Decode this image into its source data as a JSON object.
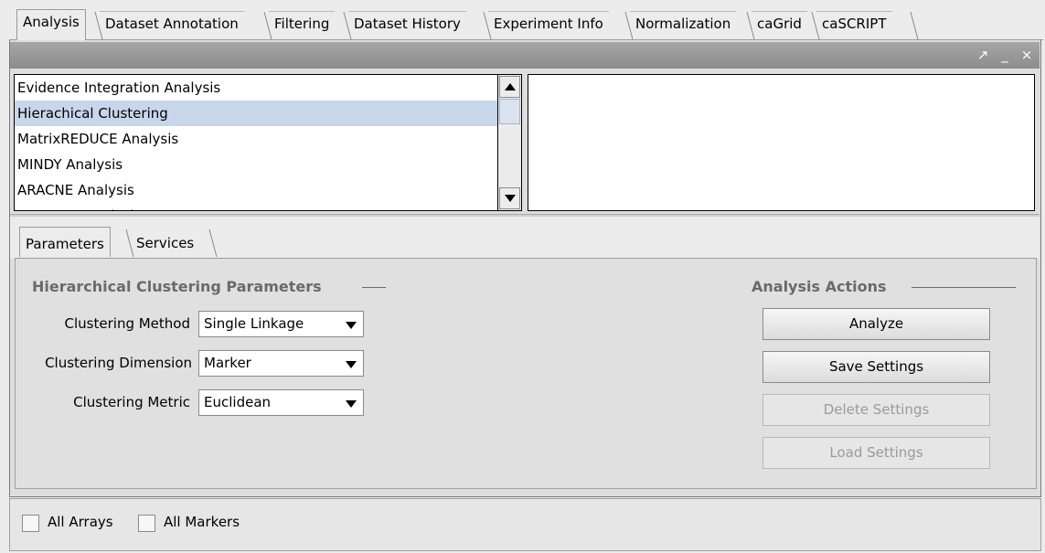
{
  "top_tabs": [
    {
      "label": "Analysis",
      "active": true
    },
    {
      "label": "Dataset Annotation"
    },
    {
      "label": "Filtering"
    },
    {
      "label": "Dataset History"
    },
    {
      "label": "Experiment Info"
    },
    {
      "label": "Normalization"
    },
    {
      "label": "caGrid"
    },
    {
      "label": "caSCRIPT"
    }
  ],
  "titlebar": {
    "icons": [
      "undock-icon",
      "minimize-icon",
      "close-icon"
    ],
    "glyphs": [
      "↗",
      "_",
      "×"
    ]
  },
  "analysis_list": {
    "items": [
      "Evidence Integration Analysis",
      "Hierachical Clustering",
      "MatrixREDUCE Analysis",
      "MINDY Analysis",
      "ARACNE Analysis",
      "NetBoost Analysis"
    ],
    "selected_index": 1
  },
  "inner_tabs": [
    {
      "label": "Parameters",
      "active": true
    },
    {
      "label": "Services"
    }
  ],
  "parameters": {
    "title": "Hierarchical Clustering Parameters",
    "fields": [
      {
        "label": "Clustering Method",
        "value": "Single Linkage"
      },
      {
        "label": "Clustering Dimension",
        "value": "Marker"
      },
      {
        "label": "Clustering Metric",
        "value": "Euclidean"
      }
    ]
  },
  "actions": {
    "title": "Analysis Actions",
    "buttons": [
      {
        "label": "Analyze",
        "enabled": true
      },
      {
        "label": "Save Settings",
        "enabled": true
      },
      {
        "label": "Delete Settings",
        "enabled": false
      },
      {
        "label": "Load Settings",
        "enabled": false
      }
    ]
  },
  "bottom": {
    "checkboxes": [
      {
        "label": "All Arrays",
        "checked": false
      },
      {
        "label": "All Markers",
        "checked": false
      }
    ]
  },
  "colors": {
    "selection": "#c7d6ea",
    "titlebar": "#9a9a9a",
    "section_title": "#6a6a6a",
    "disabled_text": "#9a9a9a"
  }
}
